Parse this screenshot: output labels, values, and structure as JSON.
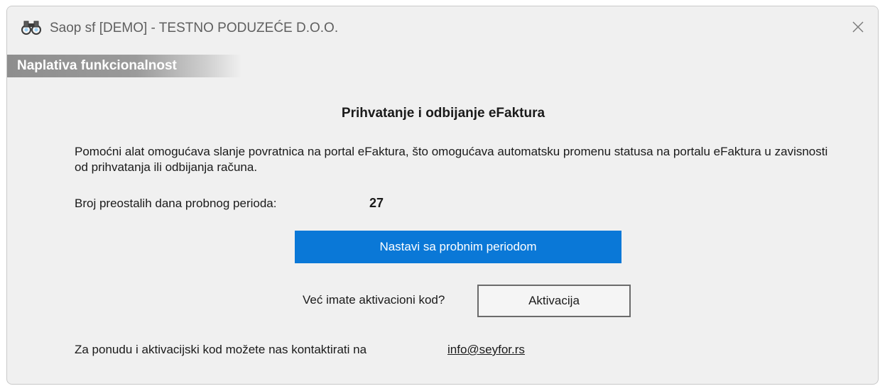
{
  "window": {
    "title": "Saop sf [DEMO] - TESTNO PODUZEĆE D.O.O.",
    "app_icon": "binoculars-icon",
    "close_icon": "close-icon"
  },
  "banner": {
    "label": "Naplativa funkcionalnost"
  },
  "content": {
    "heading": "Prihvatanje i odbijanje eFaktura",
    "description": "Pomoćni alat omogućava slanje povratnica na portal eFaktura, što omogućava automatsku promenu statusa na portalu eFaktura u zavisnosti od prihvatanja ili odbijanja računa.",
    "trial_days_label": "Broj preostalih dana probnog perioda:",
    "trial_days_value": "27",
    "continue_trial_button": "Nastavi sa probnim periodom",
    "activation_code_label": "Već imate aktivacioni kod?",
    "activate_button": "Aktivacija",
    "contact_label": "Za ponudu i aktivacijski kod možete nas kontaktirati na",
    "contact_email": "info@seyfor.rs"
  },
  "colors": {
    "primary_button": "#0a78d7",
    "dialog_background": "#f0f0f0",
    "banner_gray": "#8e8e8e"
  }
}
